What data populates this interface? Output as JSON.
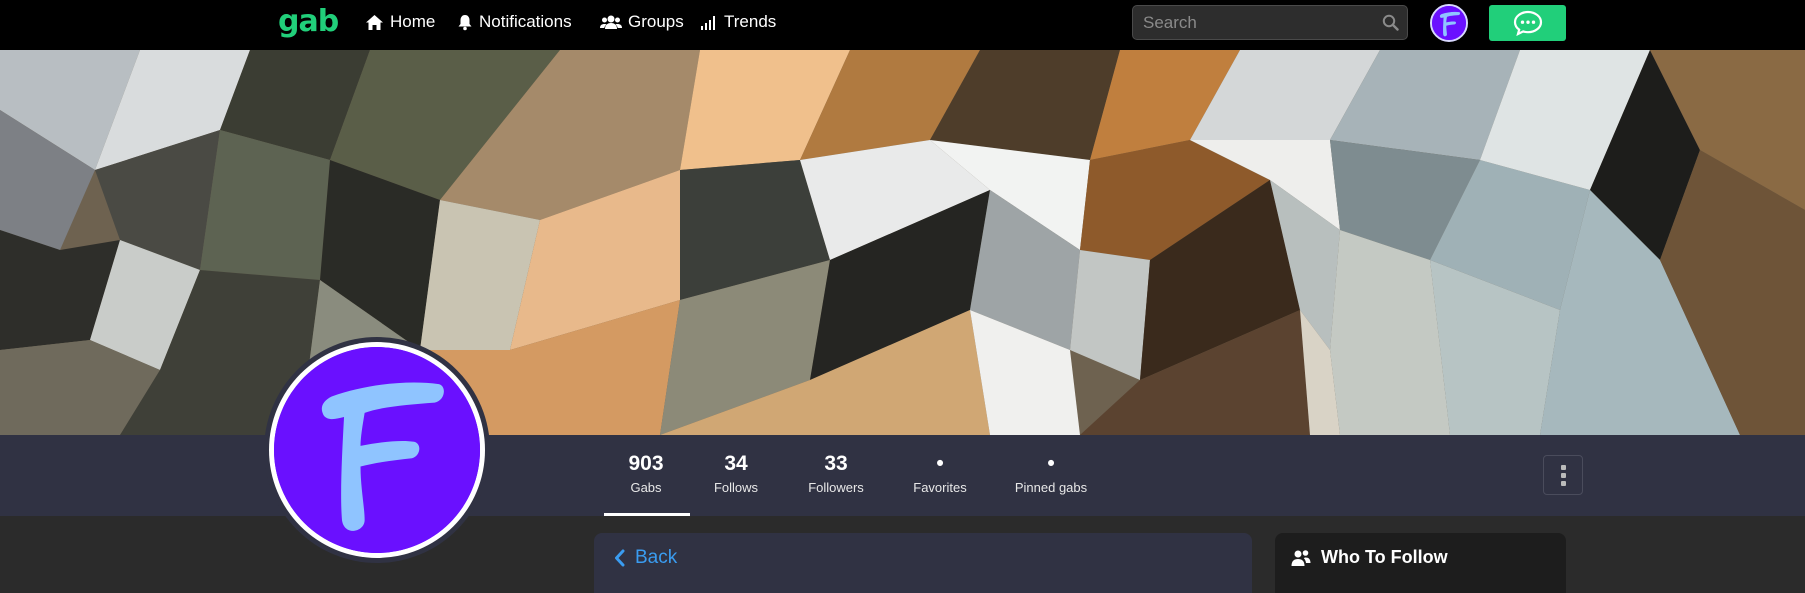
{
  "navbar": {
    "logo": "gab",
    "items": [
      {
        "label": "Home",
        "icon": "home-icon"
      },
      {
        "label": "Notifications",
        "icon": "bell-icon"
      },
      {
        "label": "Groups",
        "icon": "users-icon"
      },
      {
        "label": "Trends",
        "icon": "signal-icon"
      }
    ],
    "search": {
      "placeholder": "Search",
      "value": ""
    },
    "avatar_letter": "F",
    "chat_icon": "chat-bubble-icon"
  },
  "profile": {
    "avatar_letter": "F",
    "stats": [
      {
        "value": "903",
        "label": "Gabs"
      },
      {
        "value": "34",
        "label": "Follows"
      },
      {
        "value": "33",
        "label": "Followers"
      },
      {
        "value": "•",
        "label": "Favorites"
      },
      {
        "value": "•",
        "label": "Pinned gabs"
      }
    ],
    "active_tab": "Gabs"
  },
  "main": {
    "back_label": "Back"
  },
  "sidebar": {
    "who_to_follow_title": "Who To Follow"
  },
  "colors": {
    "brand": "#21cf7a",
    "avatar_purple": "#6a10ff",
    "avatar_letter": "#8fc4ff",
    "link": "#3a9cf0",
    "panel": "#303243"
  }
}
